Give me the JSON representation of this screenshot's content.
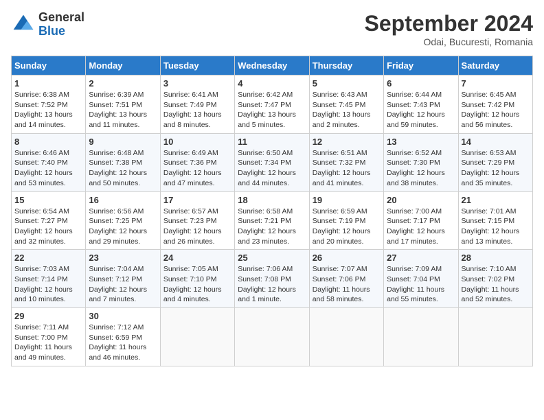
{
  "header": {
    "logo": {
      "general": "General",
      "blue": "Blue"
    },
    "title": "September 2024",
    "location": "Odai, Bucuresti, Romania"
  },
  "weekdays": [
    "Sunday",
    "Monday",
    "Tuesday",
    "Wednesday",
    "Thursday",
    "Friday",
    "Saturday"
  ],
  "weeks": [
    [
      {
        "day": "1",
        "rise": "6:38 AM",
        "set": "7:52 PM",
        "daylight": "13 hours and 14 minutes."
      },
      {
        "day": "2",
        "rise": "6:39 AM",
        "set": "7:51 PM",
        "daylight": "13 hours and 11 minutes."
      },
      {
        "day": "3",
        "rise": "6:41 AM",
        "set": "7:49 PM",
        "daylight": "13 hours and 8 minutes."
      },
      {
        "day": "4",
        "rise": "6:42 AM",
        "set": "7:47 PM",
        "daylight": "13 hours and 5 minutes."
      },
      {
        "day": "5",
        "rise": "6:43 AM",
        "set": "7:45 PM",
        "daylight": "13 hours and 2 minutes."
      },
      {
        "day": "6",
        "rise": "6:44 AM",
        "set": "7:43 PM",
        "daylight": "12 hours and 59 minutes."
      },
      {
        "day": "7",
        "rise": "6:45 AM",
        "set": "7:42 PM",
        "daylight": "12 hours and 56 minutes."
      }
    ],
    [
      {
        "day": "8",
        "rise": "6:46 AM",
        "set": "7:40 PM",
        "daylight": "12 hours and 53 minutes."
      },
      {
        "day": "9",
        "rise": "6:48 AM",
        "set": "7:38 PM",
        "daylight": "12 hours and 50 minutes."
      },
      {
        "day": "10",
        "rise": "6:49 AM",
        "set": "7:36 PM",
        "daylight": "12 hours and 47 minutes."
      },
      {
        "day": "11",
        "rise": "6:50 AM",
        "set": "7:34 PM",
        "daylight": "12 hours and 44 minutes."
      },
      {
        "day": "12",
        "rise": "6:51 AM",
        "set": "7:32 PM",
        "daylight": "12 hours and 41 minutes."
      },
      {
        "day": "13",
        "rise": "6:52 AM",
        "set": "7:30 PM",
        "daylight": "12 hours and 38 minutes."
      },
      {
        "day": "14",
        "rise": "6:53 AM",
        "set": "7:29 PM",
        "daylight": "12 hours and 35 minutes."
      }
    ],
    [
      {
        "day": "15",
        "rise": "6:54 AM",
        "set": "7:27 PM",
        "daylight": "12 hours and 32 minutes."
      },
      {
        "day": "16",
        "rise": "6:56 AM",
        "set": "7:25 PM",
        "daylight": "12 hours and 29 minutes."
      },
      {
        "day": "17",
        "rise": "6:57 AM",
        "set": "7:23 PM",
        "daylight": "12 hours and 26 minutes."
      },
      {
        "day": "18",
        "rise": "6:58 AM",
        "set": "7:21 PM",
        "daylight": "12 hours and 23 minutes."
      },
      {
        "day": "19",
        "rise": "6:59 AM",
        "set": "7:19 PM",
        "daylight": "12 hours and 20 minutes."
      },
      {
        "day": "20",
        "rise": "7:00 AM",
        "set": "7:17 PM",
        "daylight": "12 hours and 17 minutes."
      },
      {
        "day": "21",
        "rise": "7:01 AM",
        "set": "7:15 PM",
        "daylight": "12 hours and 13 minutes."
      }
    ],
    [
      {
        "day": "22",
        "rise": "7:03 AM",
        "set": "7:14 PM",
        "daylight": "12 hours and 10 minutes."
      },
      {
        "day": "23",
        "rise": "7:04 AM",
        "set": "7:12 PM",
        "daylight": "12 hours and 7 minutes."
      },
      {
        "day": "24",
        "rise": "7:05 AM",
        "set": "7:10 PM",
        "daylight": "12 hours and 4 minutes."
      },
      {
        "day": "25",
        "rise": "7:06 AM",
        "set": "7:08 PM",
        "daylight": "12 hours and 1 minute."
      },
      {
        "day": "26",
        "rise": "7:07 AM",
        "set": "7:06 PM",
        "daylight": "11 hours and 58 minutes."
      },
      {
        "day": "27",
        "rise": "7:09 AM",
        "set": "7:04 PM",
        "daylight": "11 hours and 55 minutes."
      },
      {
        "day": "28",
        "rise": "7:10 AM",
        "set": "7:02 PM",
        "daylight": "11 hours and 52 minutes."
      }
    ],
    [
      {
        "day": "29",
        "rise": "7:11 AM",
        "set": "7:00 PM",
        "daylight": "11 hours and 49 minutes."
      },
      {
        "day": "30",
        "rise": "7:12 AM",
        "set": "6:59 PM",
        "daylight": "11 hours and 46 minutes."
      },
      null,
      null,
      null,
      null,
      null
    ]
  ]
}
